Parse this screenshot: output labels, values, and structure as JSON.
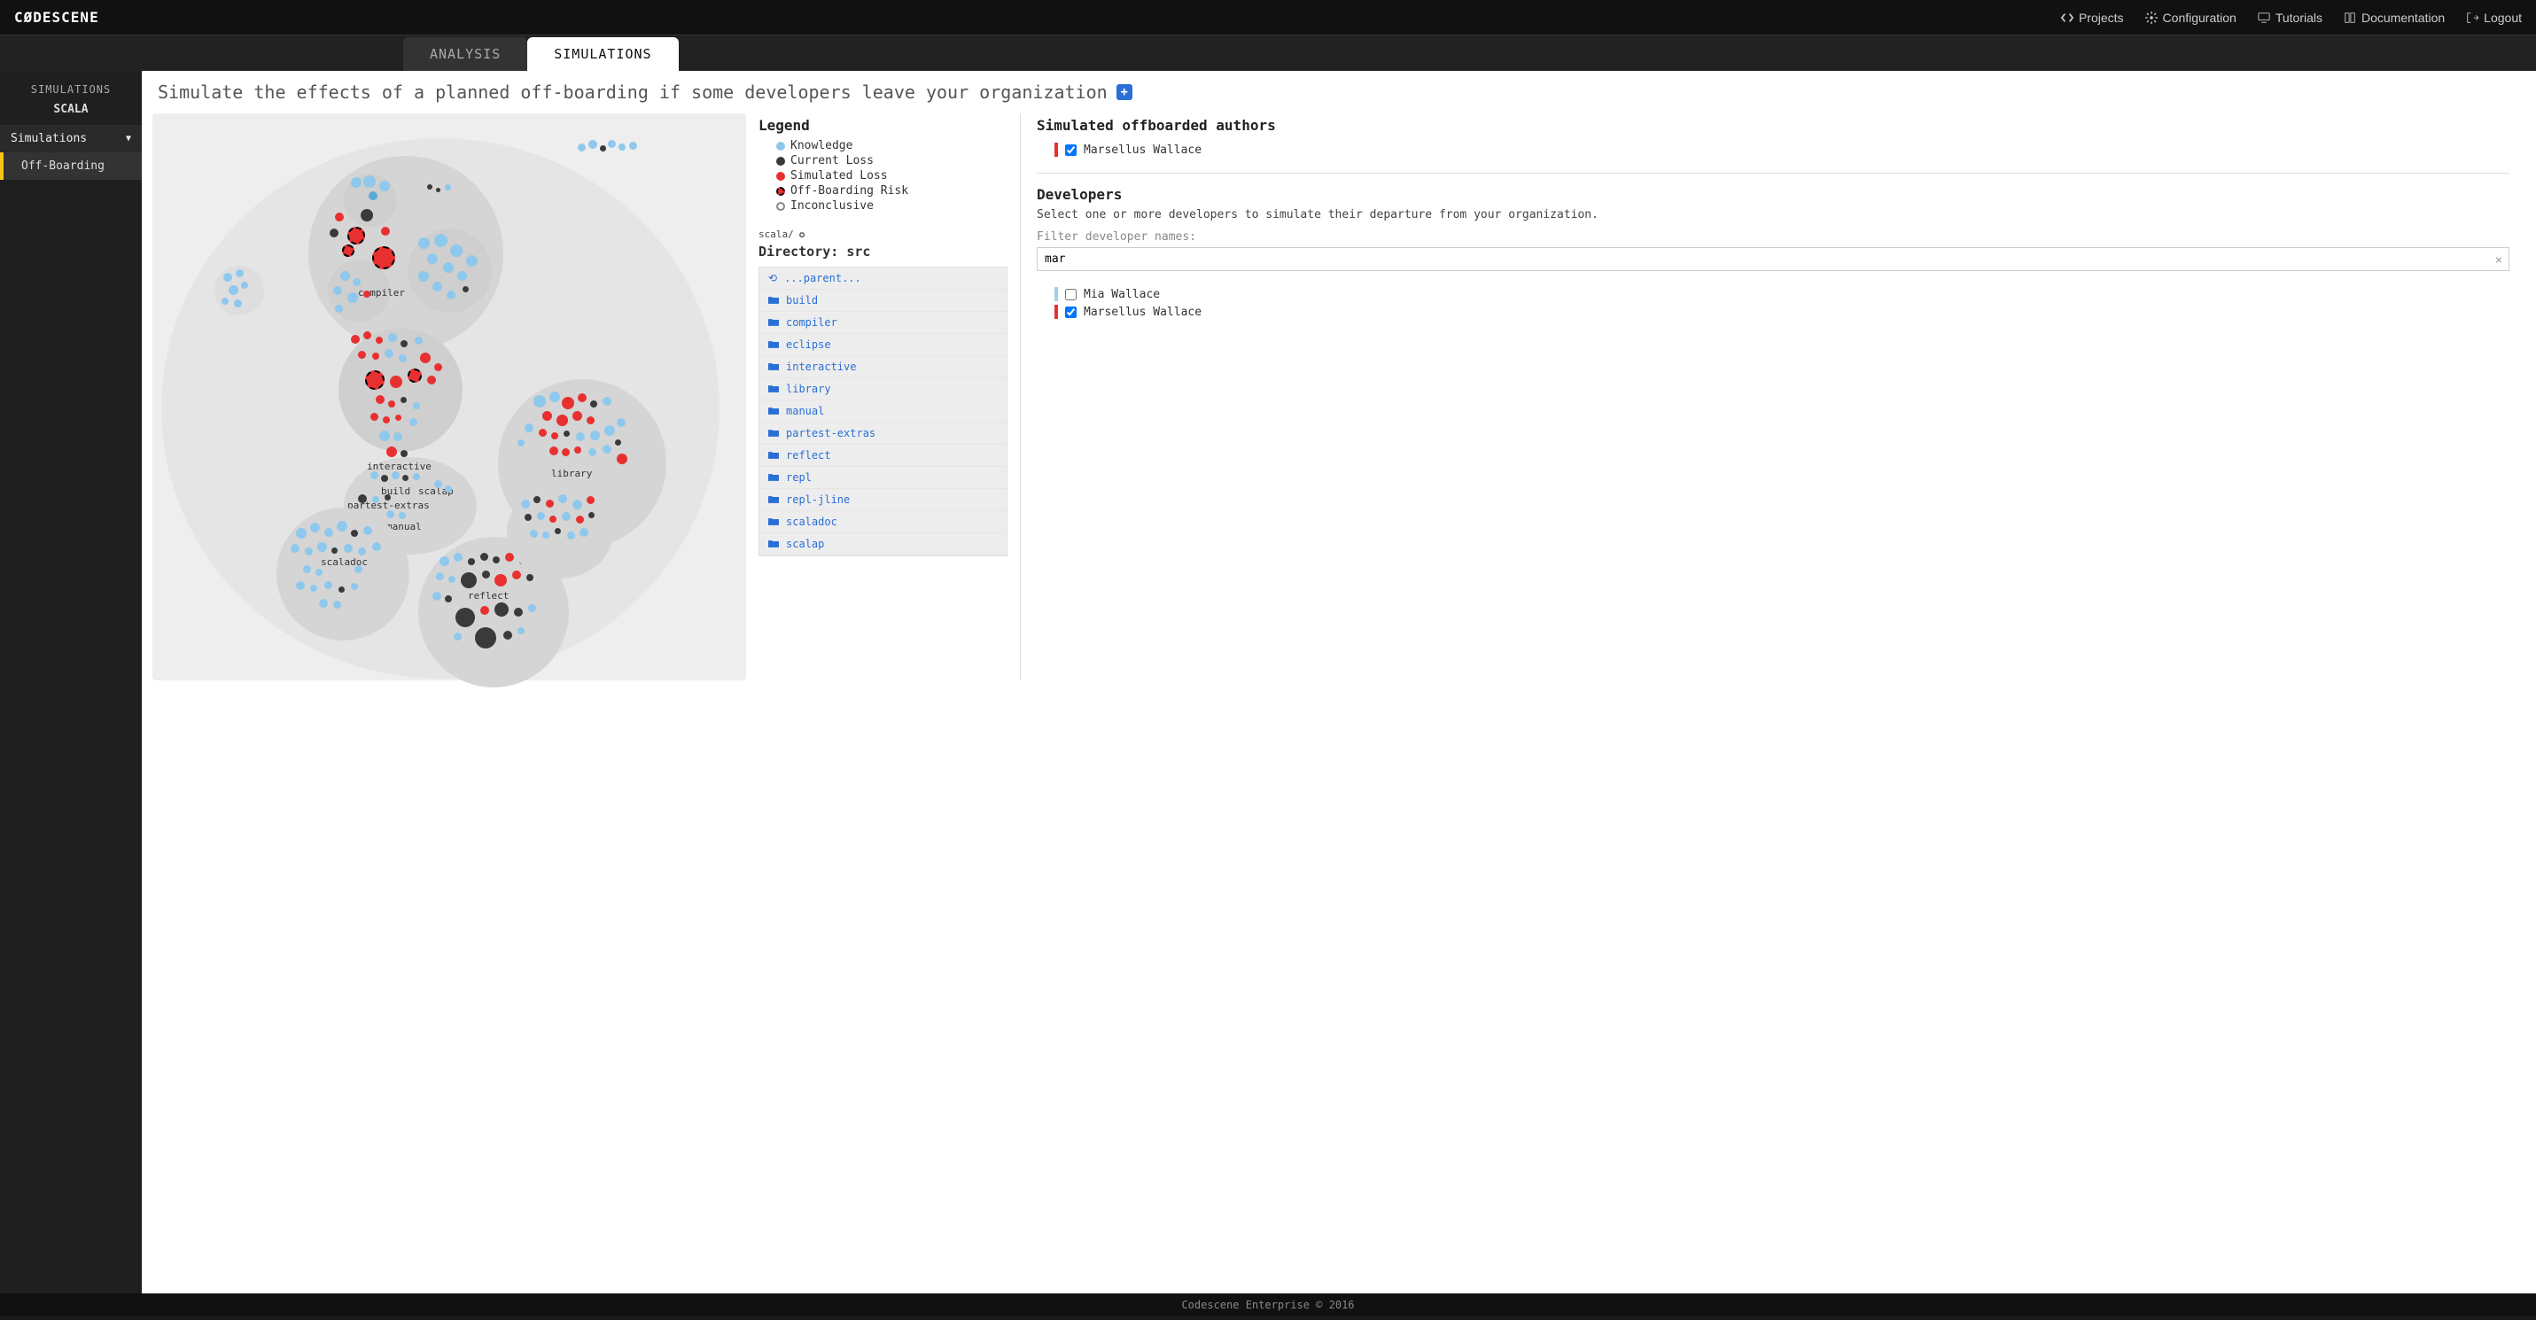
{
  "logo": "CØDESCENE",
  "topnav": {
    "projects": "Projects",
    "configuration": "Configuration",
    "tutorials": "Tutorials",
    "documentation": "Documentation",
    "logout": "Logout"
  },
  "tabs": {
    "analysis": "ANALYSIS",
    "simulations": "SIMULATIONS"
  },
  "sidebar": {
    "title": "SIMULATIONS",
    "project": "SCALA",
    "section": "Simulations",
    "item_offboarding": "Off-Boarding"
  },
  "page": {
    "headline": "Simulate the effects of a planned off-boarding if some developers leave your organization"
  },
  "legend": {
    "title": "Legend",
    "items": [
      {
        "label": "Knowledge",
        "fill": "#8fc8ed",
        "stroke": "none"
      },
      {
        "label": "Current Loss",
        "fill": "#3a3a3a",
        "stroke": "none"
      },
      {
        "label": "Simulated Loss",
        "fill": "#e83030",
        "stroke": "none"
      },
      {
        "label": "Off-Boarding Risk",
        "fill": "#e83030",
        "stroke": "#000"
      },
      {
        "label": "Inconclusive",
        "fill": "#fff",
        "stroke": "#888"
      }
    ]
  },
  "breadcrumb": {
    "path": "scala/",
    "current": "src"
  },
  "directory": {
    "label_prefix": "Directory: ",
    "name": "src",
    "parent": "...parent...",
    "items": [
      "build",
      "compiler",
      "eclipse",
      "interactive",
      "library",
      "manual",
      "partest-extras",
      "reflect",
      "repl",
      "repl-jline",
      "scaladoc",
      "scalap"
    ]
  },
  "offboarded": {
    "title": "Simulated offboarded authors",
    "authors": [
      {
        "name": "Marsellus Wallace",
        "checked": true,
        "color": "#e83030"
      }
    ]
  },
  "developers": {
    "title": "Developers",
    "help": "Select one or more developers to simulate their departure from your organization.",
    "filter_label": "Filter developer names:",
    "filter_value": "mar",
    "list": [
      {
        "name": "Mia Wallace",
        "checked": false,
        "color": "#9fd0e8"
      },
      {
        "name": "Marsellus Wallace",
        "checked": true,
        "color": "#e83030"
      }
    ]
  },
  "clusters": {
    "compiler": "compiler",
    "library": "library",
    "interactive": "interactive",
    "build": "build",
    "scalap": "scalap",
    "partest_extras": "partest-extras",
    "manual": "manual",
    "scaladoc": "scaladoc",
    "reflect": "reflect"
  },
  "footer": "Codescene Enterprise © 2016"
}
